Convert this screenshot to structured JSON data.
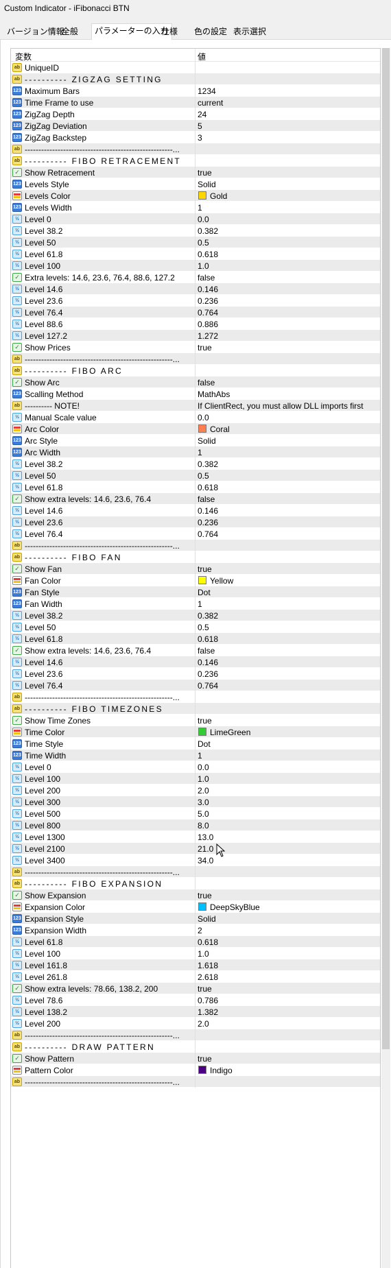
{
  "window": {
    "title": "Custom Indicator - iFibonacci BTN"
  },
  "tabs": [
    {
      "label": "バージョン情報"
    },
    {
      "label": "全般"
    },
    {
      "label": "パラメーターの入力"
    },
    {
      "label": "仕様"
    },
    {
      "label": "色の設定"
    },
    {
      "label": "表示選択"
    }
  ],
  "grid": {
    "header": {
      "variable": "変数",
      "value": "値"
    },
    "rows": [
      {
        "type": "ab",
        "name": "UniqueID",
        "value": ""
      },
      {
        "type": "ab",
        "name": "---------- ZIGZAG SETTING",
        "value": "",
        "section": true
      },
      {
        "type": "n123",
        "name": "Maximum Bars",
        "value": "1234"
      },
      {
        "type": "n123",
        "name": "Time Frame to use",
        "value": "current"
      },
      {
        "type": "n123",
        "name": "ZigZag Depth",
        "value": "24"
      },
      {
        "type": "n123",
        "name": "ZigZag Deviation",
        "value": "5"
      },
      {
        "type": "n123",
        "name": "ZigZag Backstep",
        "value": "3"
      },
      {
        "type": "ab",
        "name": "------------------------------------------------------...",
        "value": ""
      },
      {
        "type": "ab",
        "name": "---------- FIBO RETRACEMENT",
        "value": "",
        "section": true
      },
      {
        "type": "bool",
        "name": "Show Retracement",
        "value": "true"
      },
      {
        "type": "n123",
        "name": "Levels Style",
        "value": "Solid"
      },
      {
        "type": "color",
        "name": "Levels Color",
        "value": "Gold",
        "swatch": "#FFD700"
      },
      {
        "type": "n123",
        "name": "Levels Width",
        "value": "1"
      },
      {
        "type": "dbl",
        "name": "Level 0",
        "value": "0.0"
      },
      {
        "type": "dbl",
        "name": "Level 38.2",
        "value": "0.382"
      },
      {
        "type": "dbl",
        "name": "Level 50",
        "value": "0.5"
      },
      {
        "type": "dbl",
        "name": "Level 61.8",
        "value": "0.618"
      },
      {
        "type": "dbl",
        "name": "Level 100",
        "value": "1.0"
      },
      {
        "type": "bool",
        "name": "Extra levels: 14.6, 23.6, 76.4, 88.6, 127.2",
        "value": "false"
      },
      {
        "type": "dbl",
        "name": "Level 14.6",
        "value": "0.146"
      },
      {
        "type": "dbl",
        "name": "Level 23.6",
        "value": "0.236"
      },
      {
        "type": "dbl",
        "name": "Level 76.4",
        "value": "0.764"
      },
      {
        "type": "dbl",
        "name": "Level 88.6",
        "value": "0.886"
      },
      {
        "type": "dbl",
        "name": "Level 127.2",
        "value": "1.272"
      },
      {
        "type": "bool",
        "name": "Show Prices",
        "value": "true"
      },
      {
        "type": "ab",
        "name": "------------------------------------------------------...",
        "value": ""
      },
      {
        "type": "ab",
        "name": "---------- FIBO ARC",
        "value": "",
        "section": true
      },
      {
        "type": "bool",
        "name": "Show Arc",
        "value": "false"
      },
      {
        "type": "n123",
        "name": "Scalling Method",
        "value": "MathAbs"
      },
      {
        "type": "ab",
        "name": "----------  NOTE!",
        "value": "If ClientRect, you must allow DLL imports first"
      },
      {
        "type": "dbl",
        "name": "Manual Scale value",
        "value": "0.0"
      },
      {
        "type": "color",
        "name": "Arc Color",
        "value": "Coral",
        "swatch": "#FF7F50"
      },
      {
        "type": "n123",
        "name": "Arc Style",
        "value": "Solid"
      },
      {
        "type": "n123",
        "name": "Arc Width",
        "value": "1"
      },
      {
        "type": "dbl",
        "name": "Level 38.2",
        "value": "0.382"
      },
      {
        "type": "dbl",
        "name": "Level 50",
        "value": "0.5"
      },
      {
        "type": "dbl",
        "name": "Level 61.8",
        "value": "0.618"
      },
      {
        "type": "bool",
        "name": "Show extra levels: 14.6, 23.6, 76.4",
        "value": "false"
      },
      {
        "type": "dbl",
        "name": "Level 14.6",
        "value": "0.146"
      },
      {
        "type": "dbl",
        "name": "Level 23.6",
        "value": "0.236"
      },
      {
        "type": "dbl",
        "name": "Level 76.4",
        "value": "0.764"
      },
      {
        "type": "ab",
        "name": "------------------------------------------------------...",
        "value": ""
      },
      {
        "type": "ab",
        "name": "---------- FIBO FAN",
        "value": "",
        "section": true
      },
      {
        "type": "bool",
        "name": "Show Fan",
        "value": "true"
      },
      {
        "type": "color",
        "name": "Fan Color",
        "value": "Yellow",
        "swatch": "#FFFF00"
      },
      {
        "type": "n123",
        "name": "Fan Style",
        "value": "Dot"
      },
      {
        "type": "n123",
        "name": "Fan Width",
        "value": "1"
      },
      {
        "type": "dbl",
        "name": "Level 38.2",
        "value": "0.382"
      },
      {
        "type": "dbl",
        "name": "Level 50",
        "value": "0.5"
      },
      {
        "type": "dbl",
        "name": "Level 61.8",
        "value": "0.618"
      },
      {
        "type": "bool",
        "name": "Show extra levels: 14.6, 23.6, 76.4",
        "value": "false"
      },
      {
        "type": "dbl",
        "name": "Level 14.6",
        "value": "0.146"
      },
      {
        "type": "dbl",
        "name": "Level 23.6",
        "value": "0.236"
      },
      {
        "type": "dbl",
        "name": "Level 76.4",
        "value": "0.764"
      },
      {
        "type": "ab",
        "name": "------------------------------------------------------...",
        "value": ""
      },
      {
        "type": "ab",
        "name": "---------- FIBO TIMEZONES",
        "value": "",
        "section": true
      },
      {
        "type": "bool",
        "name": "Show Time Zones",
        "value": "true"
      },
      {
        "type": "color",
        "name": "Time Color",
        "value": "LimeGreen",
        "swatch": "#32CD32"
      },
      {
        "type": "n123",
        "name": "Time Style",
        "value": "Dot"
      },
      {
        "type": "n123",
        "name": "Time Width",
        "value": "1"
      },
      {
        "type": "dbl",
        "name": "Level 0",
        "value": "0.0"
      },
      {
        "type": "dbl",
        "name": "Level 100",
        "value": "1.0"
      },
      {
        "type": "dbl",
        "name": "Level 200",
        "value": "2.0"
      },
      {
        "type": "dbl",
        "name": "Level 300",
        "value": "3.0"
      },
      {
        "type": "dbl",
        "name": "Level 500",
        "value": "5.0"
      },
      {
        "type": "dbl",
        "name": "Level 800",
        "value": "8.0"
      },
      {
        "type": "dbl",
        "name": "Level 1300",
        "value": "13.0"
      },
      {
        "type": "dbl",
        "name": "Level 2100",
        "value": "21.0"
      },
      {
        "type": "dbl",
        "name": "Level 3400",
        "value": "34.0"
      },
      {
        "type": "ab",
        "name": "------------------------------------------------------...",
        "value": ""
      },
      {
        "type": "ab",
        "name": "---------- FIBO EXPANSION",
        "value": "",
        "section": true
      },
      {
        "type": "bool",
        "name": "Show Expansion",
        "value": "true"
      },
      {
        "type": "color",
        "name": "Expansion Color",
        "value": "DeepSkyBlue",
        "swatch": "#00BFFF"
      },
      {
        "type": "n123",
        "name": "Expansion Style",
        "value": "Solid"
      },
      {
        "type": "n123",
        "name": "Expansion Width",
        "value": "2"
      },
      {
        "type": "dbl",
        "name": "Level 61.8",
        "value": "0.618"
      },
      {
        "type": "dbl",
        "name": "Level 100",
        "value": "1.0"
      },
      {
        "type": "dbl",
        "name": "Level 161.8",
        "value": "1.618"
      },
      {
        "type": "dbl",
        "name": "Level 261.8",
        "value": "2.618"
      },
      {
        "type": "bool",
        "name": "Show extra levels: 78.66, 138.2, 200",
        "value": "true"
      },
      {
        "type": "dbl",
        "name": "Level 78.6",
        "value": "0.786"
      },
      {
        "type": "dbl",
        "name": "Level 138.2",
        "value": "1.382"
      },
      {
        "type": "dbl",
        "name": "Level 200",
        "value": "2.0"
      },
      {
        "type": "ab",
        "name": "------------------------------------------------------...",
        "value": ""
      },
      {
        "type": "ab",
        "name": "---------- DRAW PATTERN",
        "value": "",
        "section": true
      },
      {
        "type": "bool",
        "name": "Show Pattern",
        "value": "true"
      },
      {
        "type": "color",
        "name": "Pattern Color",
        "value": "Indigo",
        "swatch": "#4B0082"
      },
      {
        "type": "ab",
        "name": "------------------------------------------------------...",
        "value": ""
      }
    ]
  },
  "icons": {
    "ab": "string-type-icon",
    "n123": "integer-type-icon",
    "dbl": "double-type-icon",
    "bool": "boolean-type-icon",
    "color": "color-type-icon"
  },
  "icon_glyphs": {
    "ab": "ab",
    "n123": "123",
    "dbl": "½",
    "bool": "✓"
  }
}
